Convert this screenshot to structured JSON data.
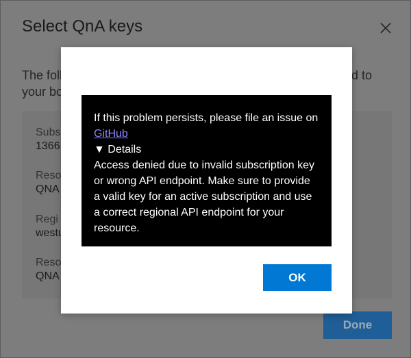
{
  "base_dialog": {
    "title": "Select QnA keys",
    "description_left": "The foll\nyour bo",
    "description_right": "d to",
    "fields": [
      {
        "label": "Subs",
        "value": "1366"
      },
      {
        "label": "Reso",
        "value": "QNA"
      },
      {
        "label": "Regi",
        "value": "westu"
      },
      {
        "label": "Reso",
        "value": "QNA"
      }
    ],
    "done_label": "Done"
  },
  "error_modal": {
    "message_prefix": "If this problem persists, please file an issue on ",
    "link_text": "GitHub",
    "details_toggle": "▼ Details",
    "details_text": "Access denied due to invalid subscription key or wrong API endpoint. Make sure to provide a valid key for an active subscription and use a correct regional API endpoint for your resource.",
    "ok_label": "OK"
  },
  "colors": {
    "primary_button": "#0078d4",
    "error_background": "#000000",
    "link": "#8f85ff",
    "overlay": "#7a7a7a"
  },
  "icons": {
    "close": "close-icon",
    "details_caret": "triangle-down-icon"
  }
}
